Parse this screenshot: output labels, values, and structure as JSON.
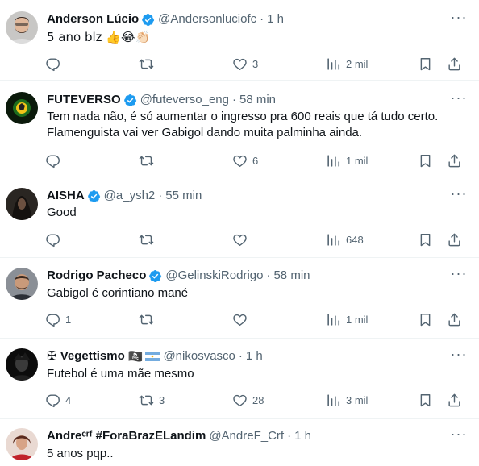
{
  "tweets": [
    {
      "name": "Anderson Lúcio",
      "handle": "@Andersonluciofc",
      "time": "1 h",
      "text": "5 ano blz 👍😂👏🏻",
      "replies": "",
      "retweets": "",
      "likes": "3",
      "views": "2 mil"
    },
    {
      "name": "FUTEVERSO",
      "handle": "@futeverso_eng",
      "time": "58 min",
      "text": "Tem nada não, é só aumentar o ingresso pra 600 reais que tá tudo certo.\nFlamenguista vai ver Gabigol dando muita palminha ainda.",
      "replies": "",
      "retweets": "",
      "likes": "6",
      "views": "1 mil"
    },
    {
      "name": "AISHA",
      "handle": "@a_ysh2",
      "time": "55 min",
      "text": "Good",
      "replies": "",
      "retweets": "",
      "likes": "",
      "views": "648"
    },
    {
      "name": "Rodrigo Pacheco",
      "handle": "@GelinskiRodrigo",
      "time": "58 min",
      "text": "Gabigol é corintiano mané",
      "replies": "1",
      "retweets": "",
      "likes": "",
      "views": "1 mil"
    },
    {
      "name": "✠ Vegettismo",
      "handle": "@nikosvasco",
      "time": "1 h",
      "text": "Futebol é uma mãe mesmo",
      "replies": "4",
      "retweets": "3",
      "likes": "28",
      "views": "3 mil"
    },
    {
      "name": "Andreᶜʳᶠ #ForaBrazELandim",
      "handle": "@AndreF_Crf",
      "time": "1 h",
      "text": "5 anos pqp..",
      "replies": "",
      "retweets": "",
      "likes": "",
      "views": ""
    }
  ],
  "icons": {
    "verified": "verified-badge-icon",
    "more": "more-options-icon",
    "reply": "reply-icon",
    "retweet": "retweet-icon",
    "like": "heart-icon",
    "views": "views-icon",
    "bookmark": "bookmark-icon",
    "share": "share-icon"
  },
  "colors": {
    "verified": "#1d9bf0",
    "secondary_text": "#536471",
    "primary_text": "#0f1419",
    "divider": "#eff3f4"
  },
  "more_label": "···",
  "pirate_emoji": "🏴‍☠️"
}
